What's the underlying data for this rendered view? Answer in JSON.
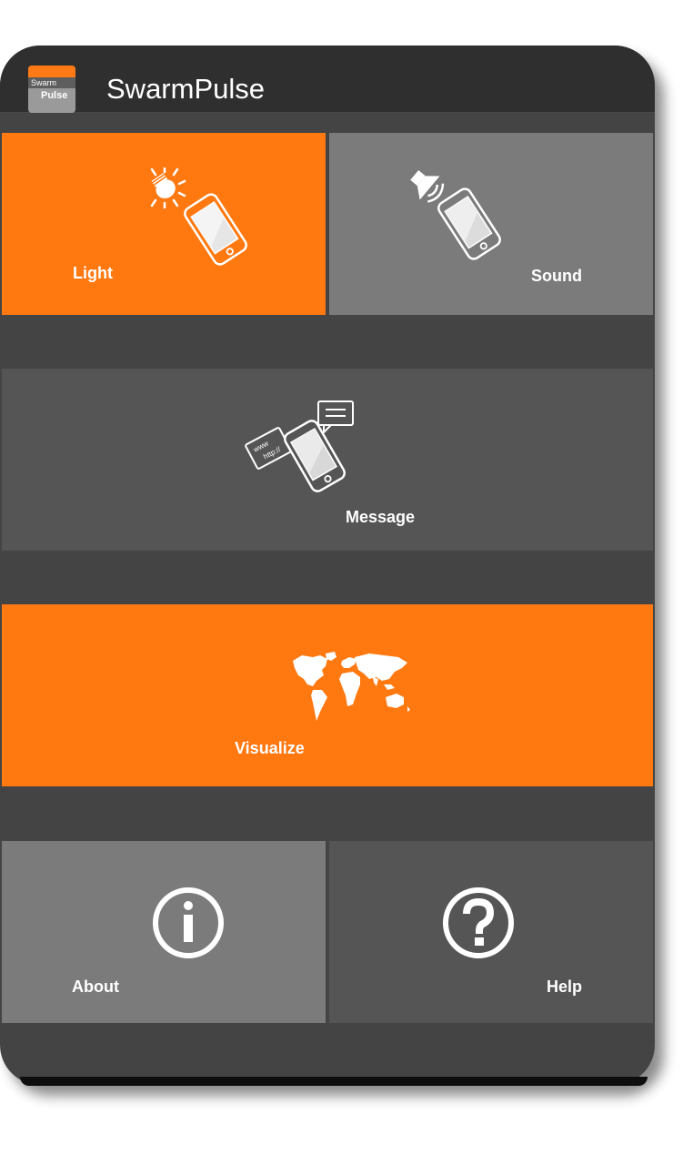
{
  "app": {
    "title": "SwarmPulse",
    "logo_line1": "Swarm",
    "logo_line2": "Pulse"
  },
  "tiles": {
    "light": {
      "label": "Light",
      "icon": "phone-lightbulb-icon"
    },
    "sound": {
      "label": "Sound",
      "icon": "phone-speaker-icon"
    },
    "message": {
      "label": "Message",
      "icon": "phone-message-icon",
      "bubble_text_1": "www",
      "bubble_text_2": "http://"
    },
    "visualize": {
      "label": "Visualize",
      "icon": "world-map-icon"
    },
    "about": {
      "label": "About",
      "icon": "info-icon"
    },
    "help": {
      "label": "Help",
      "icon": "question-icon"
    }
  },
  "colors": {
    "accent": "#ff7810",
    "tile_grey_light": "#7b7b7b",
    "tile_grey_dark": "#555555",
    "background": "#444444",
    "appbar": "#2f2f2f"
  }
}
